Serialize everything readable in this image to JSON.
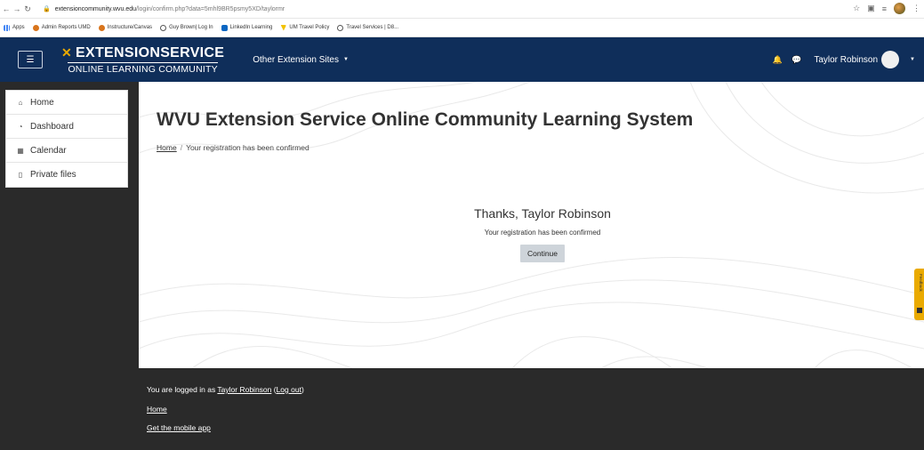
{
  "browser": {
    "url_host": "extensioncommunity.wvu.edu",
    "url_path": "/login/confirm.php?data=5mhl9BR5psmy5XD/taylormr",
    "bookmarks": [
      {
        "label": "Apps",
        "icon": "apps-grid-icon"
      },
      {
        "label": "Admin Reports UMD",
        "icon": "uh-logo-icon"
      },
      {
        "label": "Instructure/Canvas",
        "icon": "uh-logo-icon"
      },
      {
        "label": "Guy Brown| Log In",
        "icon": "globe-icon"
      },
      {
        "label": "LinkedIn Learning",
        "icon": "linkedin-icon"
      },
      {
        "label": "UM Travel Policy",
        "icon": "um-shield-icon"
      },
      {
        "label": "Travel Services | D8...",
        "icon": "globe-icon"
      }
    ]
  },
  "navbar": {
    "logo_top": "EXTENSIONSERVICE",
    "logo_sub": "ONLINE LEARNING COMMUNITY",
    "other_sites": "Other Extension Sites",
    "user_name": "Taylor Robinson",
    "colors": {
      "bar": "#0f2e5a",
      "accent": "#eaaa00"
    }
  },
  "drawer": {
    "items": [
      {
        "label": "Home",
        "icon": "home-icon"
      },
      {
        "label": "Dashboard",
        "icon": "dashboard-icon"
      },
      {
        "label": "Calendar",
        "icon": "calendar-icon"
      },
      {
        "label": "Private files",
        "icon": "file-icon"
      }
    ]
  },
  "main": {
    "title": "WVU Extension Service Online Community Learning System",
    "breadcrumb_home": "Home",
    "breadcrumb_current": "Your registration has been confirmed",
    "thanks": "Thanks, Taylor Robinson",
    "confirmed": "Your registration has been confirmed",
    "continue_label": "Continue",
    "feedback": "Feedback"
  },
  "footer": {
    "logged_in_prefix": "You are logged in as",
    "user_name": "Taylor Robinson",
    "logout": "Log out",
    "home": "Home",
    "mobile_app": "Get the mobile app"
  }
}
